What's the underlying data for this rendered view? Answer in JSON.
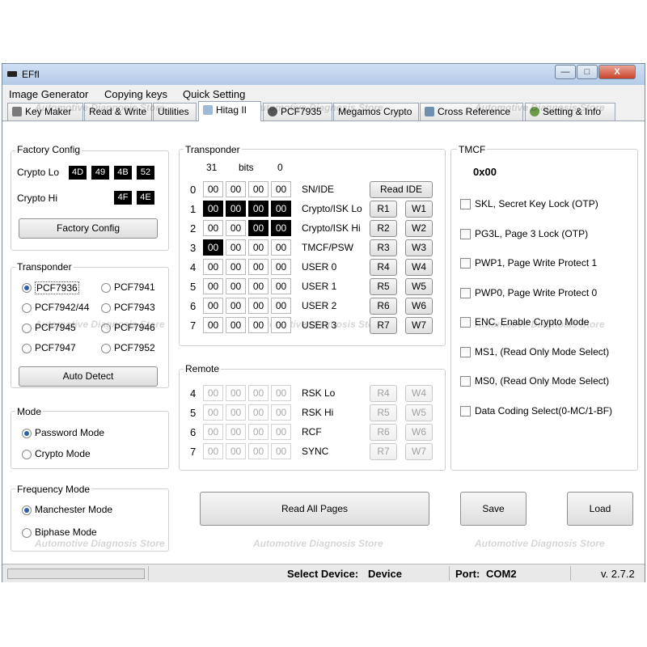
{
  "window": {
    "title": "EFfI",
    "min_label": "—",
    "max_label": "□",
    "close_label": "X"
  },
  "menu": [
    "Image Generator",
    "Copying keys",
    "Quick Setting"
  ],
  "tabs": [
    "Key Maker",
    "Read & Write",
    "Utilities",
    "Hitag II",
    "PCF7935",
    "Megamos Crypto",
    "Cross Reference",
    "Setting & Info"
  ],
  "factory_config": {
    "title": "Factory Config",
    "crypto_lo_label": "Crypto Lo",
    "crypto_lo": [
      "4D",
      "49",
      "4B",
      "52"
    ],
    "crypto_hi_label": "Crypto Hi",
    "crypto_hi": [
      "4F",
      "4E"
    ],
    "button": "Factory Config"
  },
  "transponder_types": {
    "title": "Transponder",
    "options": [
      "PCF7936",
      "PCF7941",
      "PCF7942/44",
      "PCF7943",
      "PCF7945",
      "PCF7946",
      "PCF7947",
      "PCF7952"
    ],
    "selected": "PCF7936",
    "button": "Auto Detect"
  },
  "mode": {
    "title": "Mode",
    "options": [
      "Password Mode",
      "Crypto Mode"
    ],
    "selected": "Password Mode"
  },
  "frequency_mode": {
    "title": "Frequency Mode",
    "options": [
      "Manchester Mode",
      "Biphase Mode"
    ],
    "selected": "Manchester Mode"
  },
  "transponder_pages": {
    "title": "Transponder",
    "bits_left": "31",
    "bits_label": "bits",
    "bits_right": "0",
    "rows": [
      {
        "num": "0",
        "cells": [
          "00",
          "00",
          "00",
          "00"
        ],
        "hl": [
          false,
          false,
          false,
          false
        ],
        "label": "SN/IDE",
        "read": "Read IDE",
        "write": ""
      },
      {
        "num": "1",
        "cells": [
          "00",
          "00",
          "00",
          "00"
        ],
        "hl": [
          true,
          true,
          true,
          true
        ],
        "label": "Crypto/ISK Lo",
        "read": "R1",
        "write": "W1"
      },
      {
        "num": "2",
        "cells": [
          "00",
          "00",
          "00",
          "00"
        ],
        "hl": [
          false,
          false,
          true,
          true
        ],
        "label": "Crypto/ISK Hi",
        "read": "R2",
        "write": "W2"
      },
      {
        "num": "3",
        "cells": [
          "00",
          "00",
          "00",
          "00"
        ],
        "hl": [
          true,
          false,
          false,
          false
        ],
        "label": "TMCF/PSW",
        "read": "R3",
        "write": "W3"
      },
      {
        "num": "4",
        "cells": [
          "00",
          "00",
          "00",
          "00"
        ],
        "hl": [
          false,
          false,
          false,
          false
        ],
        "label": "USER 0",
        "read": "R4",
        "write": "W4"
      },
      {
        "num": "5",
        "cells": [
          "00",
          "00",
          "00",
          "00"
        ],
        "hl": [
          false,
          false,
          false,
          false
        ],
        "label": "USER 1",
        "read": "R5",
        "write": "W5"
      },
      {
        "num": "6",
        "cells": [
          "00",
          "00",
          "00",
          "00"
        ],
        "hl": [
          false,
          false,
          false,
          false
        ],
        "label": "USER 2",
        "read": "R6",
        "write": "W6"
      },
      {
        "num": "7",
        "cells": [
          "00",
          "00",
          "00",
          "00"
        ],
        "hl": [
          false,
          false,
          false,
          false
        ],
        "label": "USER 3",
        "read": "R7",
        "write": "W7"
      }
    ]
  },
  "remote": {
    "title": "Remote",
    "rows": [
      {
        "num": "4",
        "cells": [
          "00",
          "00",
          "00",
          "00"
        ],
        "label": "RSK Lo",
        "read": "R4",
        "write": "W4"
      },
      {
        "num": "5",
        "cells": [
          "00",
          "00",
          "00",
          "00"
        ],
        "label": "RSK Hi",
        "read": "R5",
        "write": "W5"
      },
      {
        "num": "6",
        "cells": [
          "00",
          "00",
          "00",
          "00"
        ],
        "label": "RCF",
        "read": "R6",
        "write": "W6"
      },
      {
        "num": "7",
        "cells": [
          "00",
          "00",
          "00",
          "00"
        ],
        "label": "SYNC",
        "read": "R7",
        "write": "W7"
      }
    ]
  },
  "tmcf": {
    "title": "TMCF",
    "value": "0x00",
    "options": [
      "SKL, Secret Key Lock (OTP)",
      "PG3L, Page 3 Lock (OTP)",
      "PWP1, Page Write Protect 1",
      "PWP0, Page Write Protect 0",
      "ENC, Enable Crypto Mode",
      "MS1, (Read Only Mode Select)",
      "MS0, (Read Only Mode Select)",
      "Data Coding Select(0-MC/1-BF)"
    ]
  },
  "actions": {
    "read_all": "Read All Pages",
    "save": "Save",
    "load": "Load"
  },
  "status": {
    "device_label": "Select Device:",
    "device_value": "Device",
    "port_label": "Port:",
    "port_value": "COM2",
    "version": "v. 2.7.2"
  },
  "watermark": "Automotive Diagnosis Store",
  "colors": {
    "highlight": "#000000",
    "radio_dot": "#2f5fa8",
    "close_button": "#c9442a"
  }
}
